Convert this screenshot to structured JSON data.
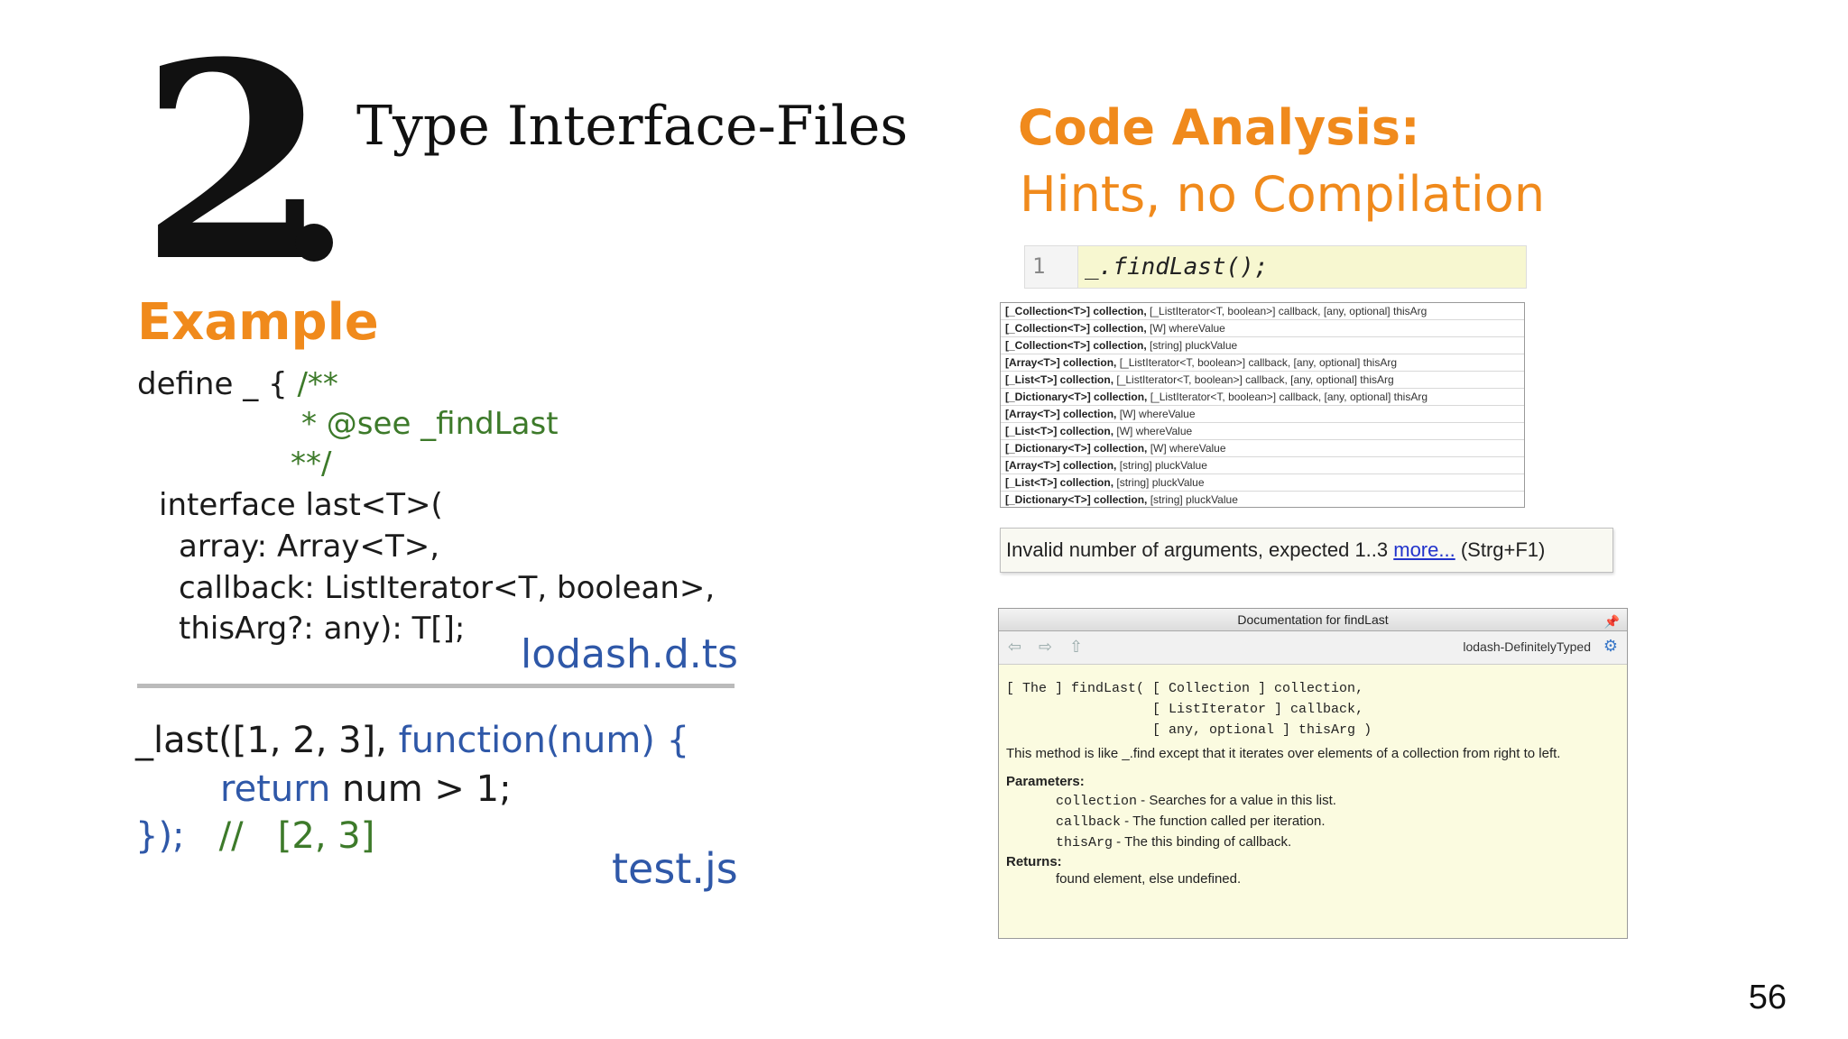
{
  "slide": {
    "number_big": "2",
    "title": "Type Interface-Files",
    "heading_right_1": "Code Analysis:",
    "heading_right_2": "Hints, no Compilation",
    "heading_left": "Example",
    "page_number": "56"
  },
  "code_ts": {
    "line1_a": "define _ {",
    "line1_b": " /**",
    "line2": "* @see _findLast",
    "line3": "**/",
    "line4": "interface last<T>(",
    "line5": "array: Array<T>,",
    "line6": "callback: ListIterator<T, boolean>,",
    "line7": "thisArg?: any): T[];",
    "filename": "lodash.d.ts"
  },
  "code_js": {
    "line1_a": "_last([1, 2, 3], ",
    "line1_b": "function(num) {",
    "line2_a": "return",
    "line2_b": " num > 1;",
    "line3_a": "});",
    "line3_b": "   //   [2, 3]",
    "filename": "test.js"
  },
  "editor": {
    "line_number": "1",
    "code": "_.findLast();"
  },
  "completion": {
    "rows": [
      {
        "bold": "[_Collection<T>] collection,",
        "rest": " [_ListIterator<T, boolean>] callback, [any, optional] thisArg"
      },
      {
        "bold": "[_Collection<T>] collection,",
        "rest": " [W] whereValue"
      },
      {
        "bold": "[_Collection<T>] collection,",
        "rest": " [string] pluckValue"
      },
      {
        "bold": "[Array<T>] collection,",
        "rest": " [_ListIterator<T, boolean>] callback, [any, optional] thisArg"
      },
      {
        "bold": "[_List<T>] collection,",
        "rest": " [_ListIterator<T, boolean>] callback, [any, optional] thisArg"
      },
      {
        "bold": "[_Dictionary<T>] collection,",
        "rest": " [_ListIterator<T, boolean>] callback, [any, optional] thisArg"
      },
      {
        "bold": "[Array<T>] collection,",
        "rest": " [W] whereValue"
      },
      {
        "bold": "[_List<T>] collection,",
        "rest": " [W] whereValue"
      },
      {
        "bold": "[_Dictionary<T>] collection,",
        "rest": " [W] whereValue"
      },
      {
        "bold": "[Array<T>] collection,",
        "rest": " [string] pluckValue"
      },
      {
        "bold": "[_List<T>] collection,",
        "rest": " [string] pluckValue"
      },
      {
        "bold": "[_Dictionary<T>] collection,",
        "rest": " [string] pluckValue"
      }
    ]
  },
  "hint": {
    "text": "Invalid number of arguments, expected 1..3 ",
    "link": "more...",
    "shortcut": " (Strg+F1)"
  },
  "doc": {
    "title": "Documentation for findLast",
    "source": "lodash-DefinitelyTyped",
    "sig1": "[ The ] findLast( [ Collection ] collection,",
    "sig2": "                  [ ListIterator ] callback,",
    "sig3": "                  [ any, optional ] thisArg )",
    "desc": "This method is like _.find except that it iterates over elements of a collection from right to left.",
    "params_label": "Parameters:",
    "p1_name": "collection",
    "p1_desc": " - Searches for a value in this list.",
    "p2_name": "callback",
    "p2_desc": " - The function called per iteration.",
    "p3_name": "thisArg",
    "p3_desc": " - The this binding of callback.",
    "returns_label": "Returns:",
    "returns_desc": "found element, else undefined."
  },
  "icons": {
    "back": "arrow-left-icon",
    "forward": "arrow-right-icon",
    "up": "arrow-up-icon",
    "pin": "pin-icon",
    "gear": "gear-icon"
  },
  "colors": {
    "accent_orange": "#f08a1c",
    "code_green": "#3d7a2a",
    "code_blue": "#2f58a8"
  }
}
